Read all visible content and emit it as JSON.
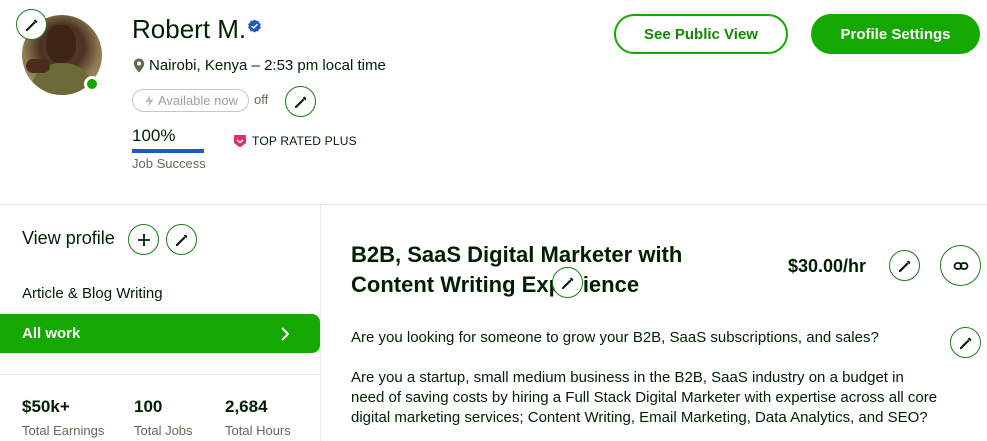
{
  "profile": {
    "name": "Robert M.",
    "location": "Nairobi, Kenya – 2:53 pm local time",
    "availability_label": "Available now",
    "availability_state": "off",
    "job_success_value": "100%",
    "job_success_fraction": 1.0,
    "job_success_label": "Job Success",
    "badge_label": "TOP RATED PLUS"
  },
  "header_actions": {
    "public_view_label": "See Public View",
    "settings_label": "Profile Settings"
  },
  "sidebar": {
    "view_profile_label": "View profile",
    "items": [
      {
        "label": "Article & Blog Writing",
        "active": false
      },
      {
        "label": "All work",
        "active": true
      }
    ],
    "stats": [
      {
        "value": "$50k+",
        "label": "Total Earnings"
      },
      {
        "value": "100",
        "label": "Total Jobs"
      },
      {
        "value": "2,684",
        "label": "Total Hours"
      }
    ]
  },
  "main": {
    "title": "B2B, SaaS Digital Marketer with Content Writing Experience",
    "rate": "$30.00/hr",
    "description": [
      "Are you looking for someone to grow your B2B, SaaS subscriptions, and sales?",
      "Are you a startup, small medium business in the B2B, SaaS industry on a budget in need of saving costs by hiring a Full Stack Digital Marketer with expertise across all core digital marketing services; Content Writing, Email Marketing, Data Analytics, and SEO?"
    ]
  },
  "colors": {
    "accent": "#14a800",
    "text": "#001e00",
    "muted": "#5e6d55",
    "job_success_bar": "#1f57c3",
    "badge": "#e1306c",
    "verified": "#1f57c3"
  },
  "icons": [
    "pencil-icon",
    "verified-badge-icon",
    "location-pin-icon",
    "lightning-icon",
    "plus-icon",
    "chevron-right-icon",
    "link-icon",
    "top-rated-plus-icon"
  ]
}
